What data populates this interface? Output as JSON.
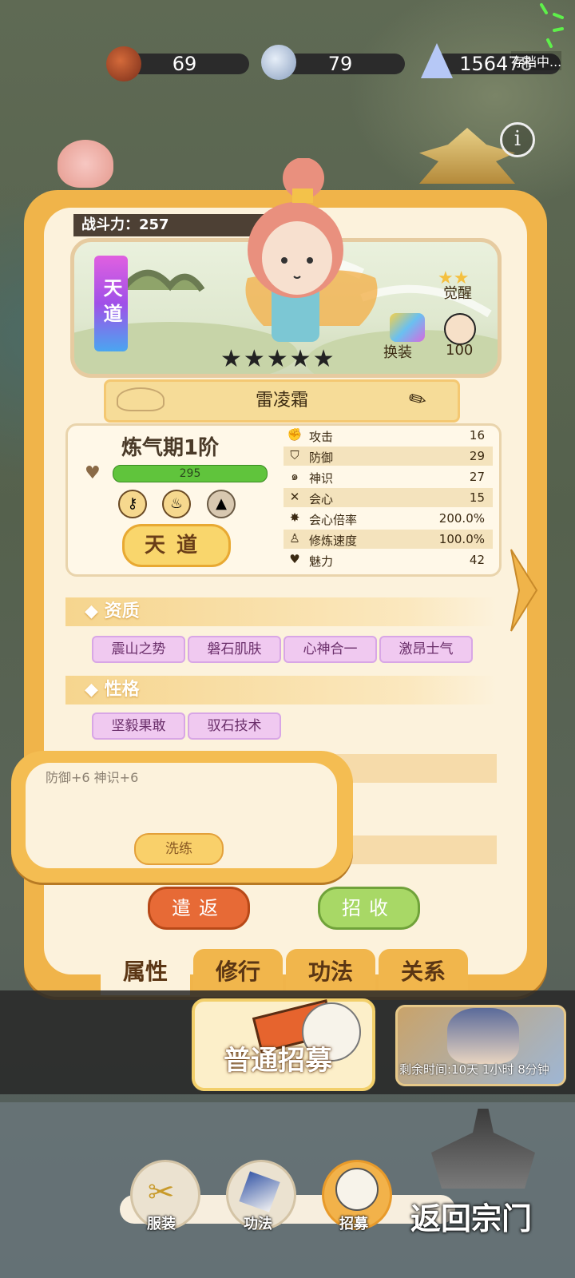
{
  "resources": [
    {
      "icon": "meat-drumstick-icon",
      "value": "69"
    },
    {
      "icon": "silver-ingot-icon",
      "value": "79"
    },
    {
      "icon": "crystal-gem-icon",
      "value": "156478"
    }
  ],
  "save_status": "存档中...",
  "panel": {
    "combat_power": "战斗力：257",
    "realm_tag": "天道",
    "stars": "★★★★★",
    "awaken_label": "觉醒",
    "outfit_label": "换装",
    "favor_value": "100",
    "character_name": "雷凌霜",
    "realm_level": "炼气期1阶",
    "hp_value": "295",
    "realm_button": "天道",
    "stats": [
      {
        "icon": "fist-icon",
        "label": "攻击",
        "value": "16"
      },
      {
        "icon": "shield-icon",
        "label": "防御",
        "value": "29"
      },
      {
        "icon": "spirit-swirl-icon",
        "label": "神识",
        "value": "27"
      },
      {
        "icon": "crossed-swords-icon",
        "label": "会心",
        "value": "15"
      },
      {
        "icon": "crit-burst-icon",
        "label": "会心倍率",
        "value": "200.0%"
      },
      {
        "icon": "meditate-icon",
        "label": "修炼速度",
        "value": "100.0%"
      },
      {
        "icon": "heart-icon",
        "label": "魅力",
        "value": "42"
      }
    ],
    "aptitude_title": "◆ 资质",
    "aptitudes": [
      "震山之势",
      "磐石肌肤",
      "心神合一",
      "激昂士气"
    ],
    "personality_title": "◆ 性格",
    "personalities": [
      "坚毅果敢",
      "驭石技术"
    ],
    "tooltip_text": "防御+6 神识+6",
    "refine_button": "洗练",
    "dismiss_button": "遣返",
    "recruit_button": "招收"
  },
  "tabs": [
    "属性",
    "修行",
    "功法",
    "关系"
  ],
  "recruit": {
    "normal_recruit": "普通招募",
    "remaining_time": "剩余时间:10天 1小时 8分钟"
  },
  "bottom_nav": {
    "items": [
      "服装",
      "功法",
      "招募"
    ],
    "back": "返回宗门"
  },
  "colors": {
    "panel_border": "#f0b44a",
    "panel_bg": "#fcf2dc",
    "hp_green": "#60c43c",
    "dismiss_red": "#e76a36",
    "recruit_green": "#a8d866"
  }
}
